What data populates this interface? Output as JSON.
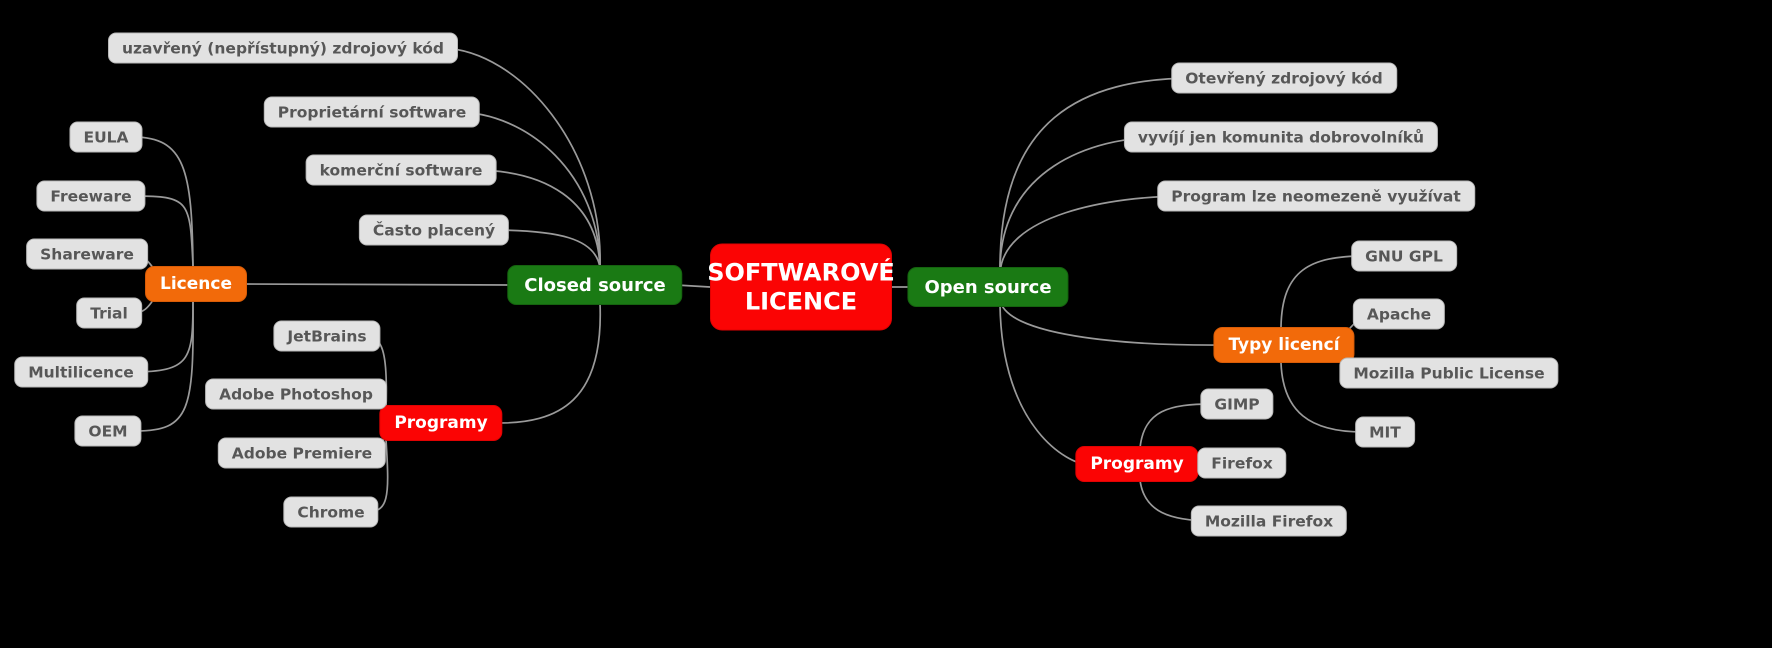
{
  "diagram": {
    "title_line1": "SOFTWAROVÉ",
    "title_line2": "LICENCE",
    "background": "#000000",
    "colors": {
      "root": "#fb0404",
      "branch_green": "#1a7a14",
      "branch_orange": "#f26a0a",
      "branch_red": "#fb0404",
      "leaf_fill": "#e2e2e2",
      "leaf_text": "#575757",
      "edge": "#9a9a9a"
    }
  },
  "nodes": {
    "root": "SOFTWAROVÉ LICENCE",
    "closed_source": "Closed source",
    "open_source": "Open source",
    "licence": "Licence",
    "programy_left": "Programy",
    "typy_licenci": "Typy licencí",
    "programy_right": "Programy"
  },
  "closed_source_children": [
    {
      "label": "uzavřený (nepřístupný) zdrojový kód"
    },
    {
      "label": "Proprietární software"
    },
    {
      "label": "komerční software"
    },
    {
      "label": "Často placený"
    }
  ],
  "licence_children": [
    {
      "label": "EULA"
    },
    {
      "label": "Freeware"
    },
    {
      "label": "Shareware"
    },
    {
      "label": "Trial"
    },
    {
      "label": "Multilicence"
    },
    {
      "label": "OEM"
    }
  ],
  "programy_left_children": [
    {
      "label": "JetBrains"
    },
    {
      "label": "Adobe Photoshop"
    },
    {
      "label": "Adobe Premiere"
    },
    {
      "label": "Chrome"
    }
  ],
  "open_source_children": [
    {
      "label": "Otevřený zdrojový kód"
    },
    {
      "label": "vyvíjí jen komunita dobrovolníků"
    },
    {
      "label": "Program lze neomezeně využívat"
    }
  ],
  "typy_licenci_children": [
    {
      "label": "GNU GPL"
    },
    {
      "label": "Apache"
    },
    {
      "label": "Mozilla Public License"
    },
    {
      "label": "MIT"
    }
  ],
  "programy_right_children": [
    {
      "label": "GIMP"
    },
    {
      "label": "Firefox"
    },
    {
      "label": "Mozilla Firefox"
    }
  ]
}
